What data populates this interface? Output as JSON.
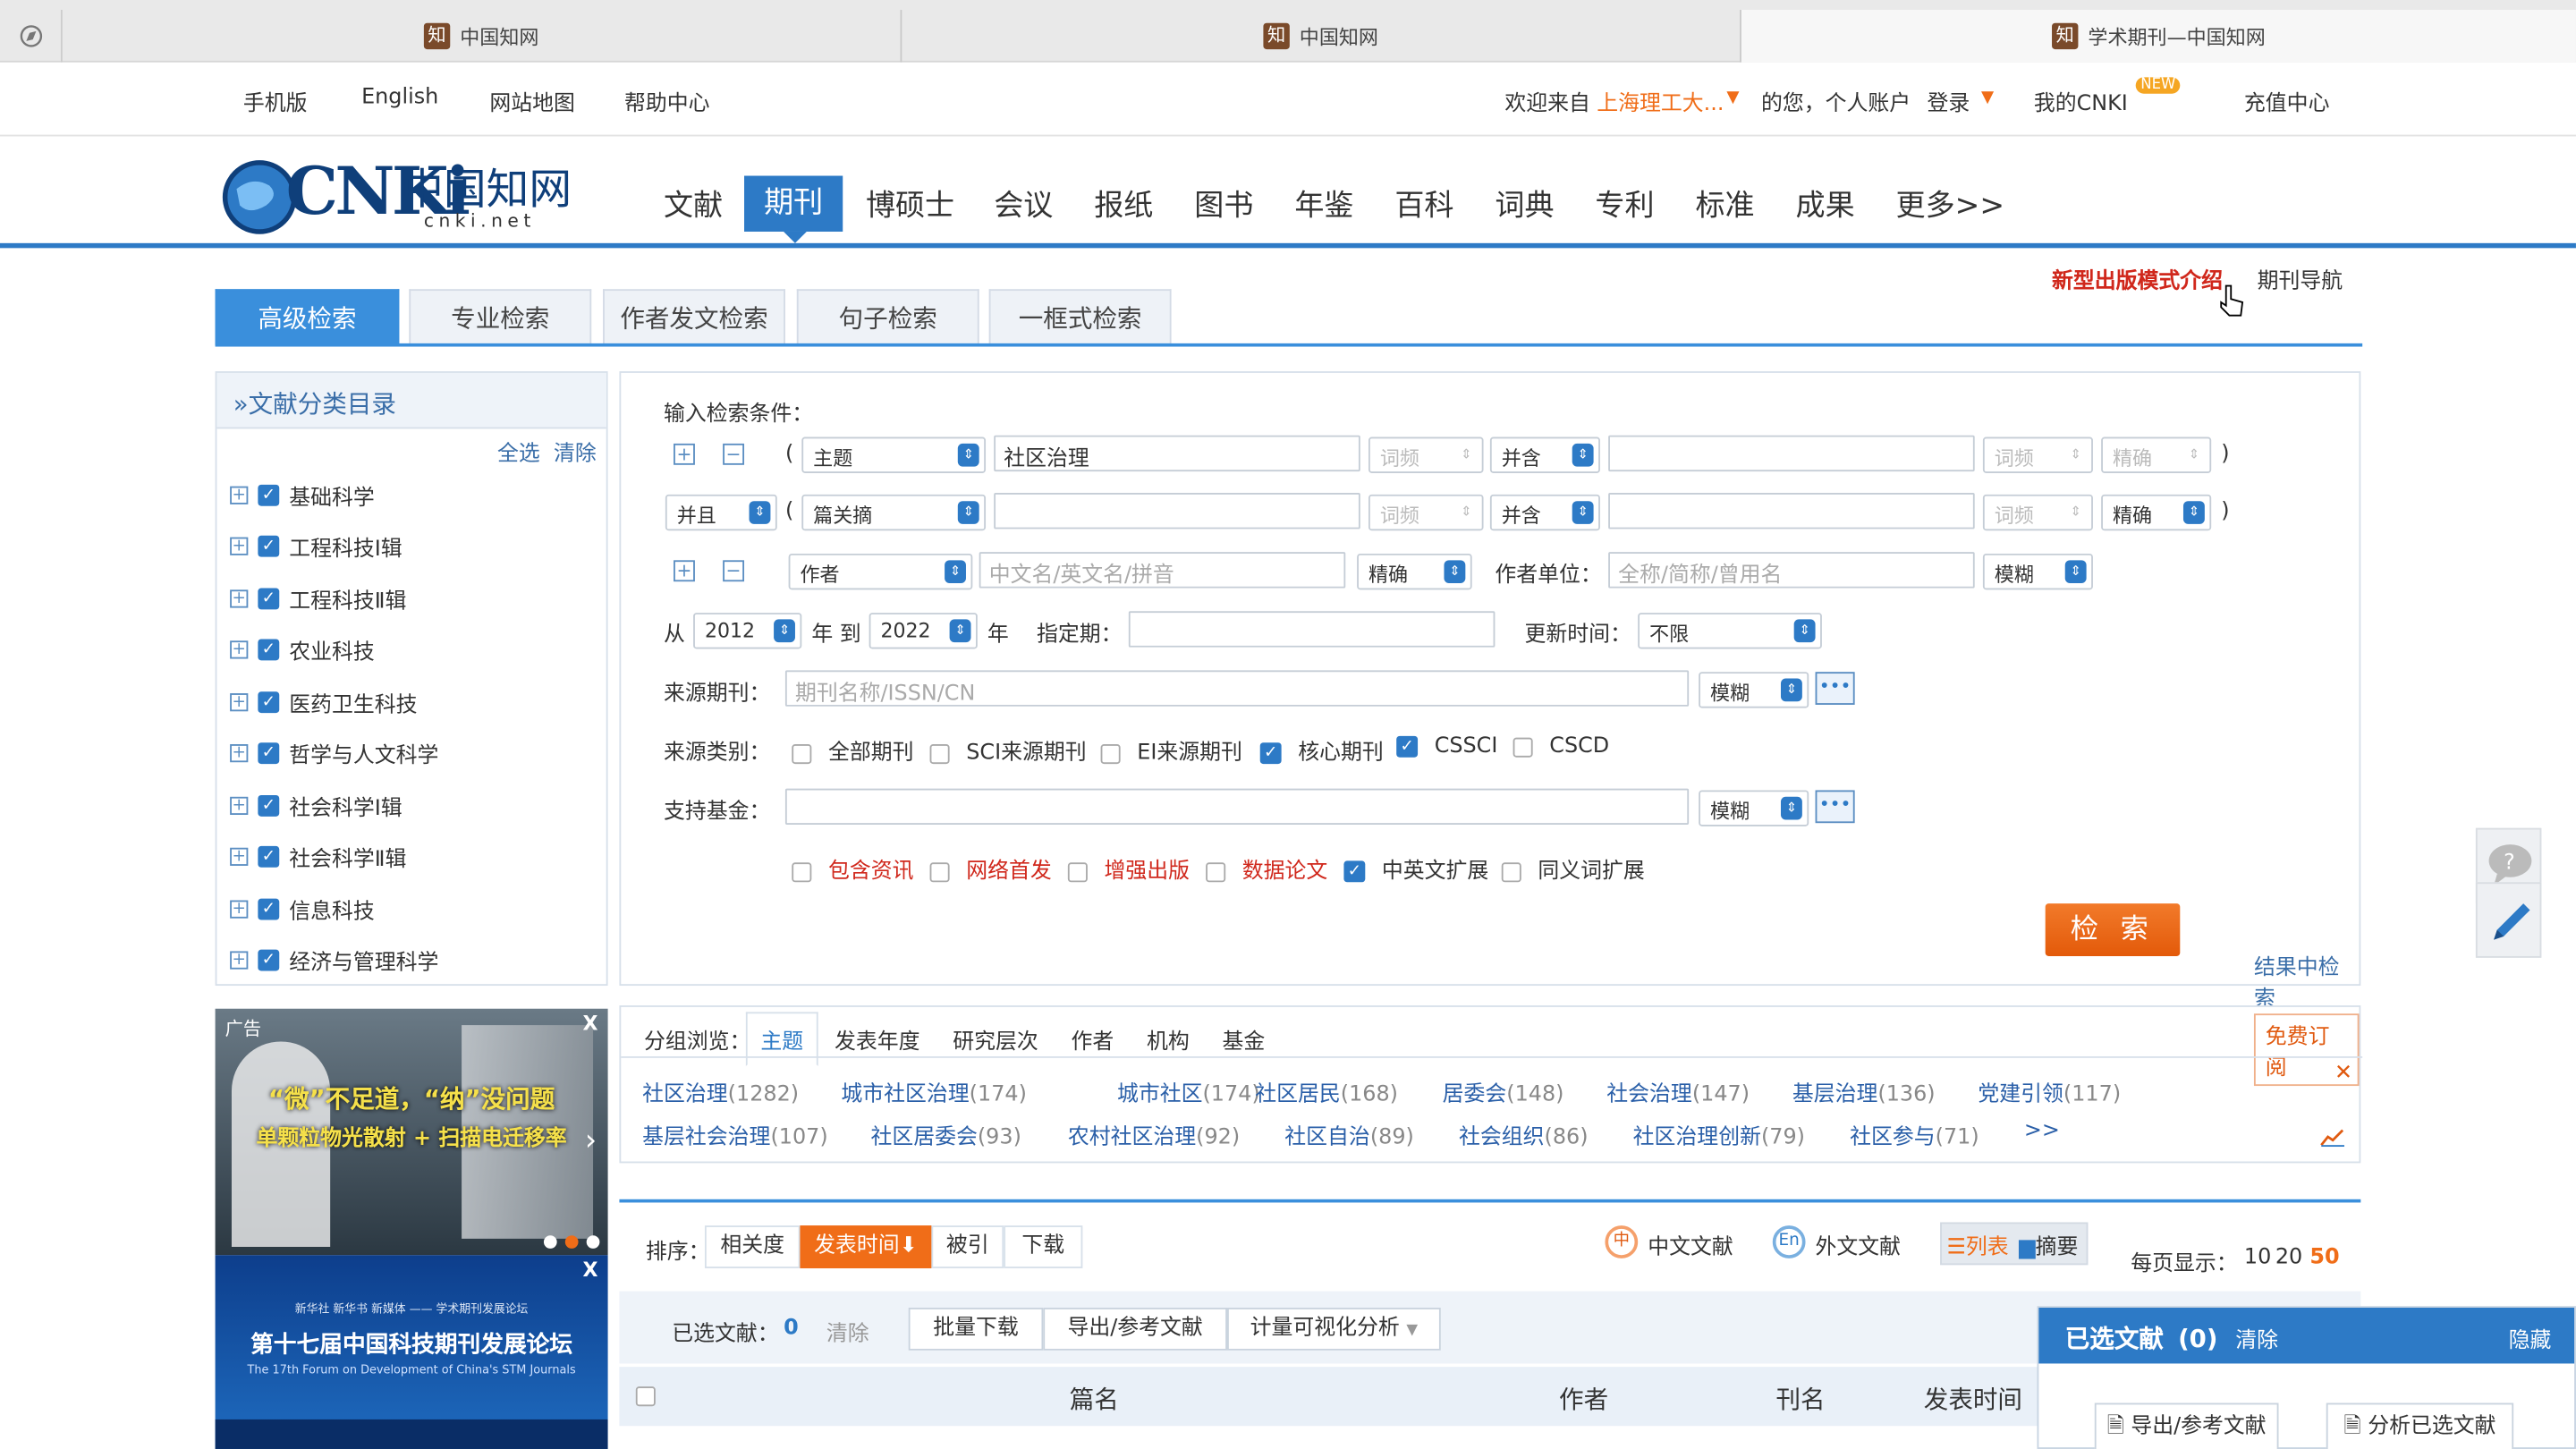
{
  "browser_tabs": [
    {
      "title": "中国知网",
      "active": false
    },
    {
      "title": "中国知网",
      "active": false
    },
    {
      "title": "学术期刊—中国知网",
      "active": true
    }
  ],
  "top_links": {
    "mobile": "手机版",
    "english": "English",
    "sitemap": "网站地图",
    "help": "帮助中心",
    "welcome_prefix": "欢迎来自",
    "institution": "上海理工大...",
    "welcome_suffix": "的您，个人账户",
    "login": "登录",
    "my_cnki": "我的CNKI",
    "new_badge": "NEW",
    "recharge": "充值中心"
  },
  "logo": {
    "text": "CNKi",
    "cn": "中国知网",
    "url": "cnki.net"
  },
  "nav": [
    "文献",
    "期刊",
    "博硕士",
    "会议",
    "报纸",
    "图书",
    "年鉴",
    "百科",
    "词典",
    "专利",
    "标准",
    "成果",
    "更多>>"
  ],
  "nav_active": "期刊",
  "right_links": {
    "intro": "新型出版模式介绍",
    "journal_nav": "期刊导航"
  },
  "search_tabs": [
    "高级检索",
    "专业检索",
    "作者发文检索",
    "句子检索",
    "一框式检索"
  ],
  "sidebar": {
    "title": "»文献分类目录",
    "select_all": "全选",
    "clear": "清除",
    "items": [
      "基础科学",
      "工程科技Ⅰ辑",
      "工程科技Ⅱ辑",
      "农业科技",
      "医药卫生科技",
      "哲学与人文科学",
      "社会科学Ⅰ辑",
      "社会科学Ⅱ辑",
      "信息科技",
      "经济与管理科学"
    ]
  },
  "ads": {
    "ad1_tag": "广告",
    "ad1_line1": "“微”不足道，“纳”没问题",
    "ad1_line2": "单颗粒物光散射 + 扫描电迁移率",
    "ad2_top": "新华社 新华书 新媒体 —— 学术期刊发展论坛",
    "ad2_title": "第十七届中国科技期刊发展论坛",
    "ad2_sub": "The 17th Forum on Development of China's STM Journals",
    "close": "X"
  },
  "form": {
    "label": "输入检索条件：",
    "row1": {
      "field": "主题",
      "value": "社区治理",
      "freq": "词频",
      "op": "并含",
      "freq2": "词频",
      "match": "精确"
    },
    "row2": {
      "logic": "并且",
      "field": "篇关摘",
      "freq": "词频",
      "op": "并含",
      "freq2": "词频",
      "match": "精确"
    },
    "row3": {
      "field": "作者",
      "placeholder": "中文名/英文名/拼音",
      "match": "精确",
      "unit_label": "作者单位：",
      "unit_placeholder": "全称/简称/曾用名",
      "unit_match": "模糊"
    },
    "date": {
      "from": "从",
      "from_year": "2012",
      "year_to": "年 到",
      "to_year": "2022",
      "year": "年",
      "fixed": "指定期：",
      "update": "更新时间：",
      "update_value": "不限"
    },
    "source": {
      "label": "来源期刊：",
      "placeholder": "期刊名称/ISSN/CN",
      "match": "模糊"
    },
    "category": {
      "label": "来源类别：",
      "options": [
        {
          "label": "全部期刊",
          "checked": false
        },
        {
          "label": "SCI来源期刊",
          "checked": false
        },
        {
          "label": "EI来源期刊",
          "checked": false
        },
        {
          "label": "核心期刊",
          "checked": true
        },
        {
          "label": "CSSCI",
          "checked": true
        },
        {
          "label": "CSCD",
          "checked": false
        }
      ]
    },
    "fund": {
      "label": "支持基金：",
      "match": "模糊"
    },
    "extras": [
      {
        "label": "包含资讯",
        "checked": false,
        "red": true
      },
      {
        "label": "网络首发",
        "checked": false,
        "red": true
      },
      {
        "label": "增强出版",
        "checked": false,
        "red": true
      },
      {
        "label": "数据论文",
        "checked": false,
        "red": true
      },
      {
        "label": "中英文扩展",
        "checked": true,
        "red": false
      },
      {
        "label": "同义词扩展",
        "checked": false,
        "red": false
      }
    ],
    "search_btn": "检 索",
    "in_results": "结果中检索"
  },
  "group": {
    "label": "分组浏览：",
    "tabs": [
      "主题",
      "发表年度",
      "研究层次",
      "作者",
      "机构",
      "基金"
    ],
    "subscribe": "免费订阅",
    "more": ">>",
    "keywords": [
      {
        "name": "社区治理",
        "count": "(1282)"
      },
      {
        "name": "城市社区治理",
        "count": "(174)"
      },
      {
        "name": "城市社区",
        "count": "(174)"
      },
      {
        "name": "社区居民",
        "count": "(168)"
      },
      {
        "name": "居委会",
        "count": "(148)"
      },
      {
        "name": "社会治理",
        "count": "(147)"
      },
      {
        "name": "基层治理",
        "count": "(136)"
      },
      {
        "name": "党建引领",
        "count": "(117)"
      },
      {
        "name": "基层社会治理",
        "count": "(107)"
      },
      {
        "name": "社区居委会",
        "count": "(93)"
      },
      {
        "name": "农村社区治理",
        "count": "(92)"
      },
      {
        "name": "社区自治",
        "count": "(89)"
      },
      {
        "name": "社会组织",
        "count": "(86)"
      },
      {
        "name": "社区治理创新",
        "count": "(79)"
      },
      {
        "name": "社区参与",
        "count": "(71)"
      }
    ]
  },
  "results": {
    "sort_label": "排序：",
    "sorts": [
      "相关度",
      "发表时间",
      "被引",
      "下载"
    ],
    "cn_docs": "中文文献",
    "foreign_docs": "外文文献",
    "list": "列表",
    "abstract": "摘要",
    "per_page_label": "每页显示：",
    "per_page": [
      "10",
      "20",
      "50"
    ],
    "per_page_active": "50",
    "selected_label": "已选文献：",
    "selected_count": "0",
    "clear": "清除",
    "batch_download": "批量下载",
    "export": "导出/参考文献",
    "visual": "计量可视化分析",
    "columns": [
      "篇名",
      "作者",
      "刊名",
      "发表时间"
    ]
  },
  "float_panel": {
    "title": "已选文献",
    "count": "(0)",
    "clear": "清除",
    "hide": "隐藏",
    "export": "导出/参考文献",
    "analyze": "分析已选文献"
  },
  "colors": {
    "primary": "#2d7ac6",
    "orange": "#f06d18",
    "red": "#d0281c"
  }
}
